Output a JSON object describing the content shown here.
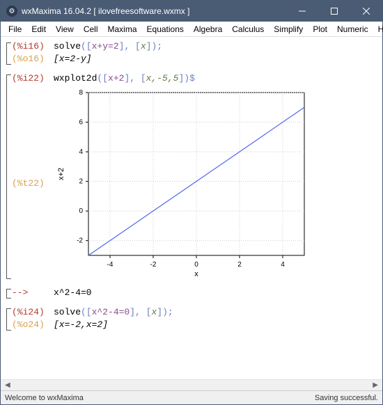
{
  "window": {
    "title": "wxMaxima 16.04.2   [ ilovefreesoftware.wxmx ]"
  },
  "menu": [
    "File",
    "Edit",
    "View",
    "Cell",
    "Maxima",
    "Equations",
    "Algebra",
    "Calculus",
    "Simplify",
    "Plot",
    "Numeric",
    "Help"
  ],
  "cells": {
    "c1": {
      "in_label": "(%i16)",
      "in_cmd": "solve",
      "in_args_open": "([",
      "in_expr": "x+y=2",
      "in_args_mid": "], [",
      "in_var": "x",
      "in_args_close": "]);",
      "out_label": "(%o16)",
      "out_result": "[x=2-y]"
    },
    "c2": {
      "in_label": "(%i22)",
      "in_cmd": "wxplot2d",
      "in_args_open": "([",
      "in_expr": "x+2",
      "in_args_mid": "], [",
      "in_var": "x,-5,5",
      "in_args_close": "])$",
      "t_label": "(%t22)"
    },
    "c3": {
      "arrow": "-->",
      "expr": "x^2-4=0"
    },
    "c4": {
      "in_label": "(%i24)",
      "in_cmd": "solve",
      "in_args_open": "([",
      "in_expr": "x^2-4=0",
      "in_args_mid": "], [",
      "in_var": "x",
      "in_args_close": "]);",
      "out_label": "(%o24)",
      "out_result": "[x=-2,x=2]"
    }
  },
  "status": {
    "left": "Welcome to wxMaxima",
    "right": "Saving successful."
  },
  "chart_data": {
    "type": "line",
    "title": "",
    "xlabel": "x",
    "ylabel": "x+2",
    "xlim": [
      -5,
      5
    ],
    "ylim": [
      -3,
      8
    ],
    "xticks": [
      -4,
      -2,
      0,
      2,
      4
    ],
    "yticks": [
      -2,
      0,
      2,
      4,
      6,
      8
    ],
    "series": [
      {
        "name": "x+2",
        "x": [
          -5,
          -4,
          -3,
          -2,
          -1,
          0,
          1,
          2,
          3,
          4,
          5
        ],
        "y": [
          -3,
          -2,
          -1,
          0,
          1,
          2,
          3,
          4,
          5,
          6,
          7
        ]
      }
    ]
  }
}
